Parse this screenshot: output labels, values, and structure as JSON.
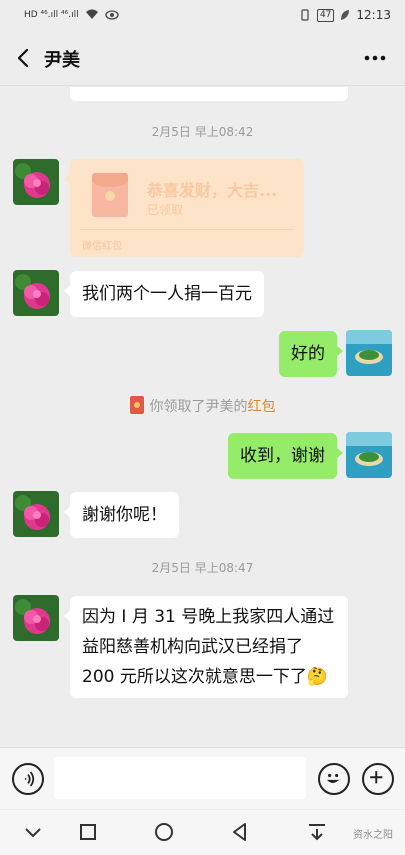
{
  "status_bar": {
    "left": "HD ⁴⁶.ıll ⁴⁶.ıll",
    "battery": "47",
    "time": "12:13"
  },
  "header": {
    "title": "尹美",
    "back_icon": "chevron-left-icon",
    "more_icon": "ellipsis-icon"
  },
  "messages": {
    "timestamp_1": "2月5日 早上08:42",
    "hongbao": {
      "title": "恭喜发财，大吉...",
      "status": "已领取",
      "footer": "微信红包"
    },
    "msg_1": "我们两个一人捐一百元",
    "msg_2": "好的",
    "system": {
      "prefix": "你领取了尹美的",
      "link": "红包"
    },
    "msg_3": "收到，谢谢",
    "msg_4": "謝谢你呢！",
    "timestamp_2": "2月5日 早上08:47",
    "msg_5": "因为 I 月 31 号晚上我家四人通过益阳慈善机构向武汉已经捐了 200 元所以这次就意思一下了🤔"
  },
  "input_bar": {
    "voice_icon": "voice-icon",
    "emoji_icon": "emoji-icon",
    "plus_icon": "plus-icon"
  },
  "nav_bar": {
    "watermark": "资水之阳"
  },
  "colors": {
    "background": "#ededed",
    "outgoing_bubble": "#95ec69",
    "incoming_bubble": "#ffffff",
    "hongbao": "#fde3c7"
  }
}
